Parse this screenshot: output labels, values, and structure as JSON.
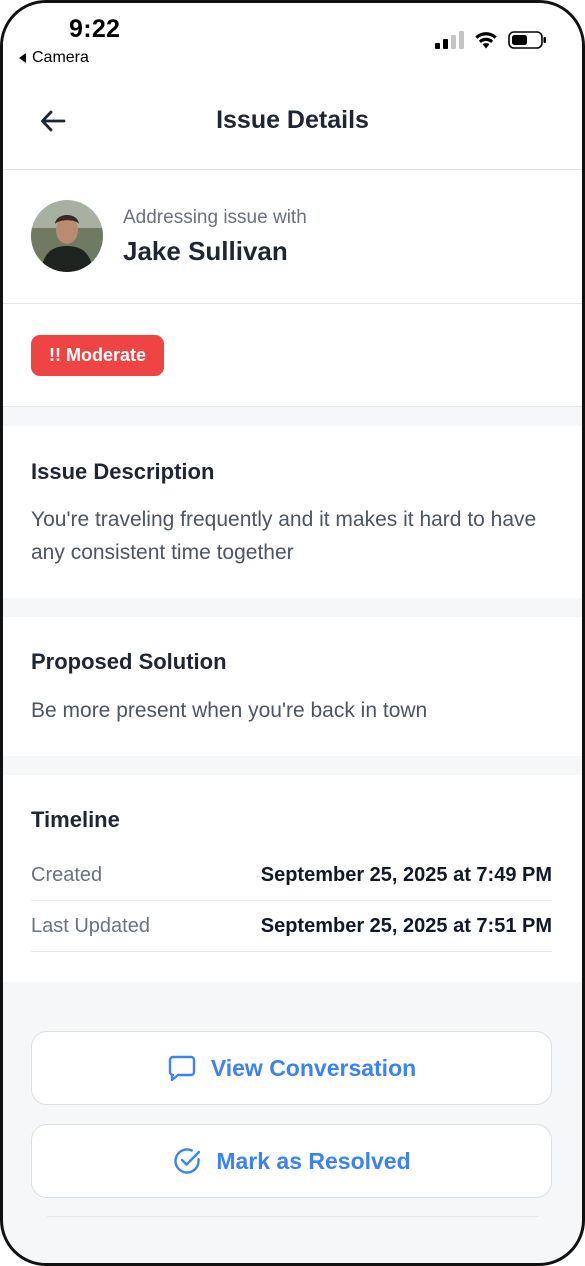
{
  "status_bar": {
    "time": "9:22",
    "back_app": "Camera"
  },
  "header": {
    "title": "Issue Details"
  },
  "partner": {
    "prefix": "Addressing issue with",
    "name": "Jake Sullivan"
  },
  "severity": {
    "label": "!! Moderate",
    "color": "#ef4444"
  },
  "description": {
    "heading": "Issue Description",
    "text": "You're traveling frequently and it makes it hard to have any consistent time together"
  },
  "solution": {
    "heading": "Proposed Solution",
    "text": "Be more present when you're back in town"
  },
  "timeline": {
    "heading": "Timeline",
    "rows": [
      {
        "label": "Created",
        "value": "September 25, 2025 at 7:49 PM"
      },
      {
        "label": "Last Updated",
        "value": "September 25, 2025 at 7:51 PM"
      }
    ]
  },
  "actions": {
    "view_conversation": "View Conversation",
    "mark_resolved": "Mark as Resolved",
    "accent": "#3b82f6"
  }
}
